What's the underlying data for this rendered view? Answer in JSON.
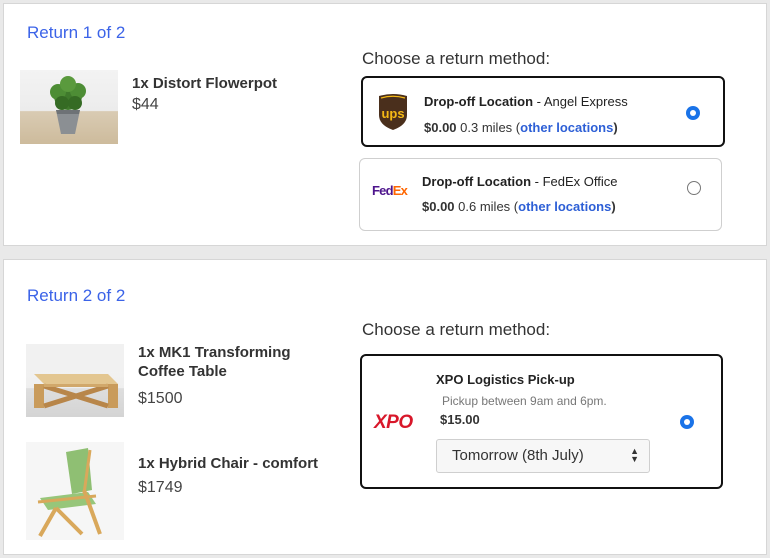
{
  "returns": [
    {
      "title": "Return 1 of 2",
      "items": [
        {
          "qty_name": "1x Distort Flowerpot",
          "price": "$44"
        }
      ],
      "choose_label": "Choose a return method:",
      "options": [
        {
          "carrier": "UPS",
          "logo_text": "ups",
          "type": "Drop-off Location",
          "sep": " - ",
          "location": "Angel Express",
          "price": "$0.00",
          "distance": " 0.3 miles (",
          "link": "other locations",
          "close": ")",
          "selected": true
        },
        {
          "carrier": "FedEx",
          "logo_fed": "Fed",
          "logo_ex": "Ex",
          "type": "Drop-off Location",
          "sep": " - ",
          "location": "FedEx Office",
          "price": "$0.00",
          "distance": " 0.6 miles (",
          "link": "other locations",
          "close": ")",
          "selected": false
        }
      ]
    },
    {
      "title": "Return 2 of 2",
      "items": [
        {
          "qty_name": "1x MK1 Transforming Coffee Table",
          "price": "$1500"
        },
        {
          "qty_name": "1x Hybrid Chair - comfort",
          "price": "$1749"
        }
      ],
      "choose_label": "Choose a return method:",
      "options": [
        {
          "carrier": "XPO",
          "logo_text": "XPO",
          "type": "XPO Logistics Pick-up",
          "note": "Pickup between 9am and 6pm.",
          "price": "$15.00",
          "date_select": "Tomorrow (8th July)",
          "selected": true
        }
      ]
    }
  ],
  "colors": {
    "accent": "#3b63e8",
    "link": "#2d5fd6",
    "radio": "#1a73e8",
    "ups_brown": "#4a2f1c",
    "ups_gold": "#f5b915",
    "fedex_purple": "#4d148c",
    "fedex_orange": "#ff6600",
    "xpo_red": "#d8172a"
  }
}
